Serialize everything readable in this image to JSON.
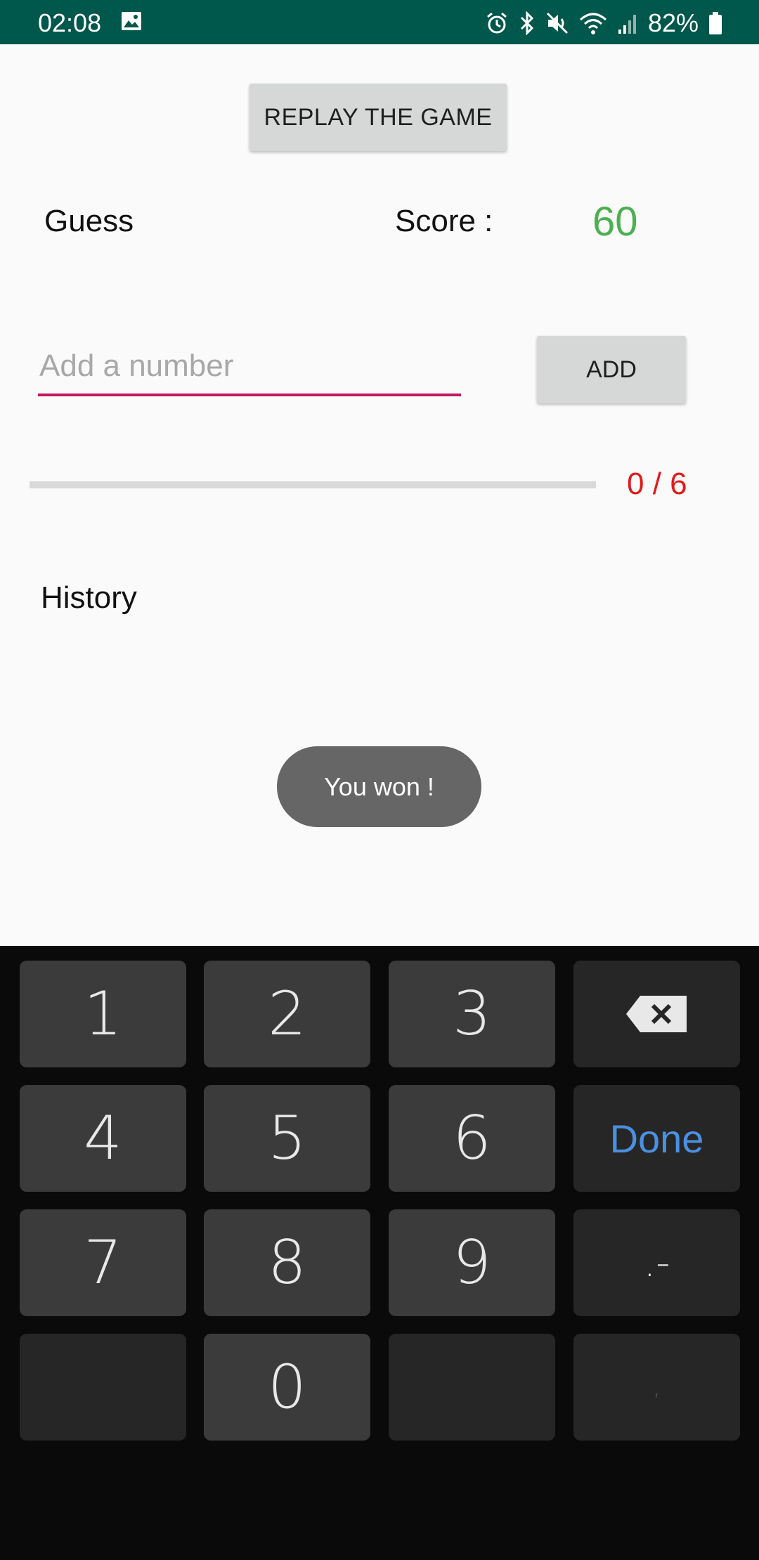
{
  "status_bar": {
    "time": "02:08",
    "battery": "82%"
  },
  "app": {
    "replay_button": "REPLAY THE GAME",
    "guess_label": "Guess",
    "score_label": "Score :",
    "score_value": "60",
    "input_placeholder": "Add a number",
    "input_value": "",
    "add_button": "ADD",
    "progress_text": "0 / 6",
    "progress_fraction": 0,
    "history_label": "History",
    "toast_message": "You won !"
  },
  "keyboard": {
    "keys": [
      {
        "label": "1"
      },
      {
        "label": "2"
      },
      {
        "label": "3"
      },
      {
        "label": ""
      },
      {
        "label": "4"
      },
      {
        "label": "5"
      },
      {
        "label": "6"
      },
      {
        "label": "Done"
      },
      {
        "label": "7"
      },
      {
        "label": "8"
      },
      {
        "label": "9"
      },
      {
        "label": ".-"
      },
      {
        "label": ""
      },
      {
        "label": "0"
      },
      {
        "label": ""
      },
      {
        "label": ","
      }
    ]
  },
  "colors": {
    "status_bar": "#00574b",
    "accent": "#c2185b",
    "score": "#4caf50",
    "progress_text": "#e01b1b",
    "done_key": "#4a90e2"
  }
}
